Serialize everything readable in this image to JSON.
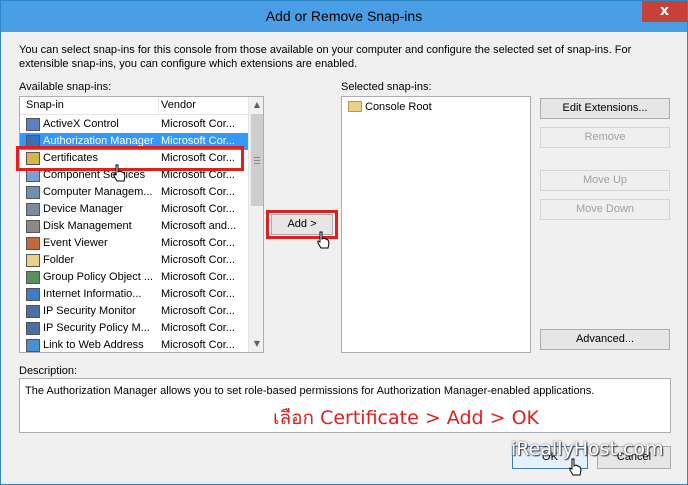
{
  "window": {
    "title": "Add or Remove Snap-ins",
    "close_glyph": "x"
  },
  "intro_text": "You can select snap-ins for this console from those available on your computer and configure the selected set of snap-ins. For extensible snap-ins, you can configure which extensions are enabled.",
  "available": {
    "label": "Available snap-ins:",
    "columns": [
      "Snap-in",
      "Vendor"
    ],
    "items": [
      {
        "name": "ActiveX Control",
        "vendor": "Microsoft Cor...",
        "icon": "activex-icon"
      },
      {
        "name": "Authorization Manager",
        "vendor": "Microsoft Cor...",
        "icon": "authorization-manager-icon"
      },
      {
        "name": "Certificates",
        "vendor": "Microsoft Cor...",
        "icon": "certificates-icon"
      },
      {
        "name": "Component Services",
        "vendor": "Microsoft Cor...",
        "icon": "component-services-icon"
      },
      {
        "name": "Computer Managem...",
        "vendor": "Microsoft Cor...",
        "icon": "computer-management-icon"
      },
      {
        "name": "Device Manager",
        "vendor": "Microsoft Cor...",
        "icon": "device-manager-icon"
      },
      {
        "name": "Disk Management",
        "vendor": "Microsoft and...",
        "icon": "disk-management-icon"
      },
      {
        "name": "Event Viewer",
        "vendor": "Microsoft Cor...",
        "icon": "event-viewer-icon"
      },
      {
        "name": "Folder",
        "vendor": "Microsoft Cor...",
        "icon": "folder-icon"
      },
      {
        "name": "Group Policy Object ...",
        "vendor": "Microsoft Cor...",
        "icon": "group-policy-icon"
      },
      {
        "name": "Internet Informatio...",
        "vendor": "Microsoft Cor...",
        "icon": "internet-information-icon"
      },
      {
        "name": "IP Security Monitor",
        "vendor": "Microsoft Cor...",
        "icon": "ip-security-monitor-icon"
      },
      {
        "name": "IP Security Policy M...",
        "vendor": "Microsoft Cor...",
        "icon": "ip-security-policy-icon"
      },
      {
        "name": "Link to Web Address",
        "vendor": "Microsoft Cor...",
        "icon": "link-icon"
      }
    ],
    "selected_index": 1
  },
  "add_button": "Add >",
  "selected": {
    "label": "Selected snap-ins:",
    "items": [
      "Console Root"
    ]
  },
  "side_buttons": {
    "edit_extensions": "Edit Extensions...",
    "remove": "Remove",
    "move_up": "Move Up",
    "move_down": "Move Down",
    "advanced": "Advanced..."
  },
  "description": {
    "label": "Description:",
    "text": "The Authorization Manager allows you to set role-based permissions for Authorization Manager-enabled applications."
  },
  "annotation_text": "เลือก Certificate > Add > OK",
  "watermark": "iReallyHost.com",
  "footer": {
    "ok": "OK",
    "cancel": "Cancel"
  },
  "colors": {
    "titlebar": "#4a9ee6",
    "selection": "#3399ff",
    "annotation_red": "#e0201e",
    "close_button": "#c7403a"
  }
}
